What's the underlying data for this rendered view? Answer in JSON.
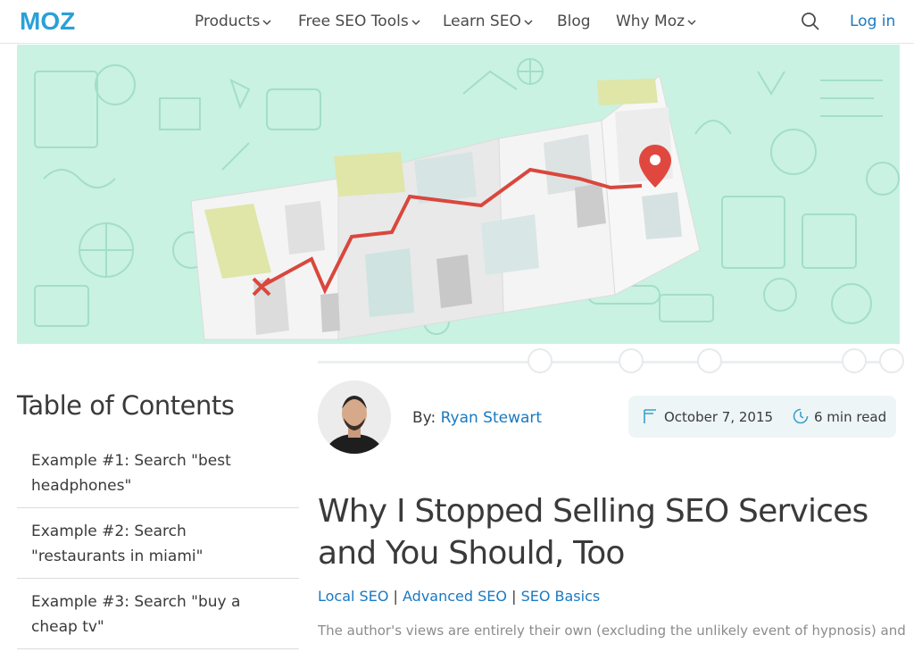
{
  "brand": {
    "logo_text": "MOZ",
    "accent": "#1a79c1",
    "logo_color": "#2aa0d8"
  },
  "nav": {
    "items": [
      {
        "label": "Products",
        "dropdown": true
      },
      {
        "label": "Free SEO Tools",
        "dropdown": true
      },
      {
        "label": "Learn SEO",
        "dropdown": true
      },
      {
        "label": "Blog",
        "dropdown": false
      },
      {
        "label": "Why Moz",
        "dropdown": true
      }
    ],
    "search_icon": "search-icon",
    "login_label": "Log in"
  },
  "hero": {
    "icon": "map-route-illustration",
    "background": "#c9f2e2"
  },
  "toc": {
    "title": "Table of Contents",
    "items": [
      "Example #1: Search \"best headphones\"",
      "Example #2: Search \"restaurants in miami\"",
      "Example #3: Search \"buy a cheap tv\""
    ]
  },
  "author": {
    "by_label": "By:",
    "name": "Ryan Stewart"
  },
  "meta": {
    "date": "October 7, 2015",
    "read_time": "6 min read"
  },
  "article": {
    "title": "Why I Stopped Selling SEO Services and You Should, Too",
    "tags": [
      "Local SEO",
      "Advanced SEO",
      "SEO Basics"
    ],
    "tag_separator": "|",
    "disclaimer": "The author's views are entirely their own (excluding the unlikely event of hypnosis) and may"
  }
}
